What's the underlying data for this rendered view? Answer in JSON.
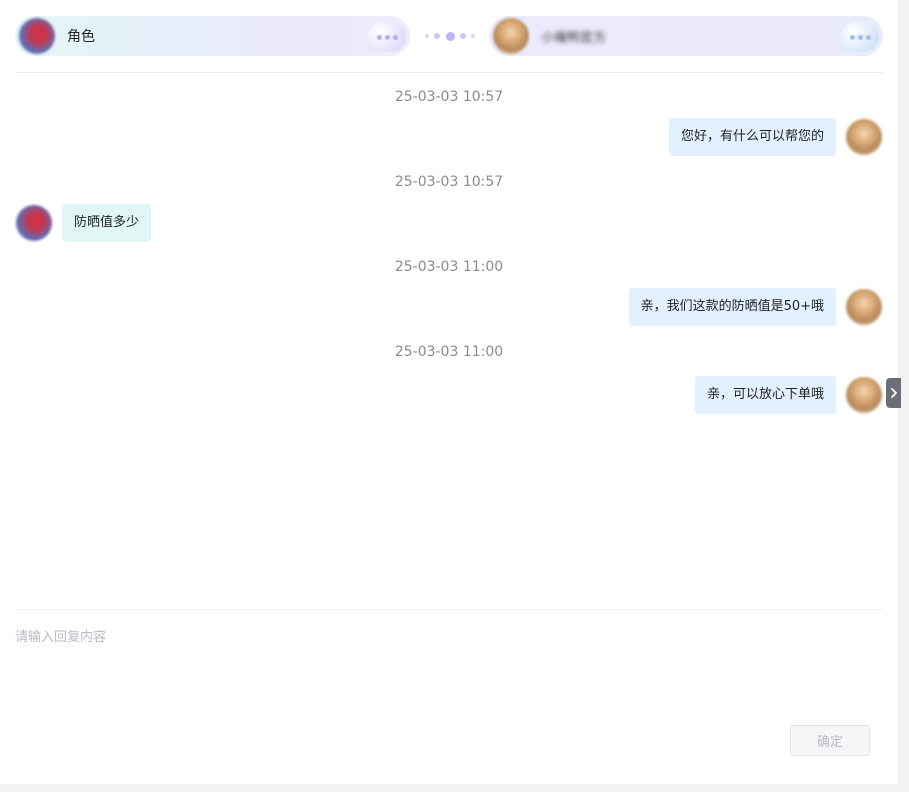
{
  "header": {
    "left_participant": {
      "name": "角色",
      "avatar_icon": "role-avatar"
    },
    "right_participant": {
      "name": "小嘴鸭官方",
      "avatar_icon": "agent-avatar"
    },
    "connector_icon": "dots-connector"
  },
  "messages": [
    {
      "time": "25-03-03 10:57",
      "side": "right",
      "text": "您好，有什么可以帮您的"
    },
    {
      "time": "25-03-03 10:57",
      "side": "left",
      "text": "防晒值多少"
    },
    {
      "time": "25-03-03 11:00",
      "side": "right",
      "text": "亲，我们这款的防晒值是50+哦"
    },
    {
      "time": "25-03-03 11:00",
      "side": "right",
      "text": "亲，可以放心下单哦"
    }
  ],
  "composer": {
    "placeholder": "请输入回复内容",
    "value": "",
    "confirm_label": "确定"
  },
  "colors": {
    "sent_bubble": "#e3f0ff",
    "received_bubble": "#e0f7f6",
    "timestamp_text": "#888b91"
  }
}
